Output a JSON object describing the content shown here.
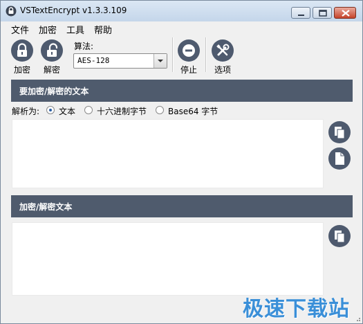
{
  "window": {
    "title": "VSTextEncrypt v1.3.3.109"
  },
  "menu": {
    "items": [
      "文件",
      "加密",
      "工具",
      "帮助"
    ]
  },
  "toolbar": {
    "encrypt_label": "加密",
    "decrypt_label": "解密",
    "algorithm_label": "算法:",
    "algorithm_value": "AES-128",
    "stop_label": "停止",
    "options_label": "选项"
  },
  "input_section": {
    "title": "要加密/解密的文本",
    "parse_label": "解析为:",
    "options": [
      {
        "label": "文本",
        "checked": true
      },
      {
        "label": "十六进制字节",
        "checked": false
      },
      {
        "label": "Base64 字节",
        "checked": false
      }
    ],
    "text": ""
  },
  "output_section": {
    "title": "加密/解密文本",
    "text": ""
  },
  "watermark": "极速下载站",
  "colors": {
    "header_bg": "#4f5b6d",
    "icon_bg": "#4e5a6e",
    "watermark": "#3a8fd8"
  },
  "icons": [
    "lock-icon",
    "unlock-icon",
    "stop-icon",
    "tools-icon",
    "paste-icon",
    "new-document-icon",
    "copy-icon"
  ]
}
